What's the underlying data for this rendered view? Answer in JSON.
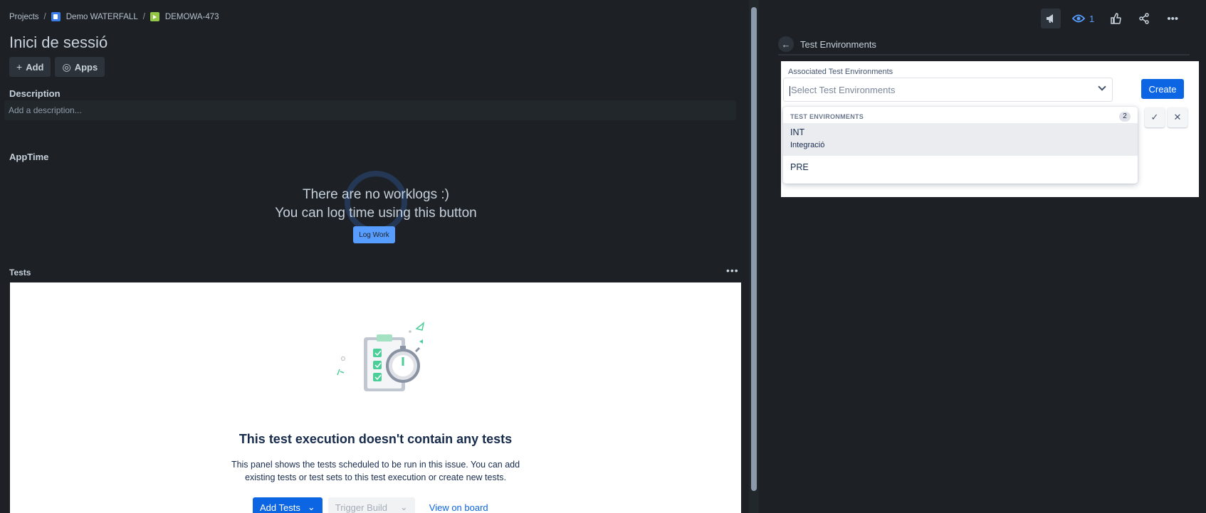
{
  "breadcrumb": {
    "projects": "Projects",
    "project": "Demo WATERFALL",
    "issue": "DEMOWA-473"
  },
  "issue": {
    "title": "Inici de sessió",
    "add_label": "Add",
    "apps_label": "Apps"
  },
  "description": {
    "label": "Description",
    "placeholder": "Add a description..."
  },
  "apptime": {
    "label": "AppTime",
    "line1": "There are no worklogs :)",
    "line2": "You can log time using this button",
    "button": "Log Work"
  },
  "tests": {
    "label": "Tests",
    "more": "•••",
    "empty_title": "This test execution doesn't contain any tests",
    "empty_body_1": "This panel shows the tests scheduled to be run in this issue. You can add",
    "empty_body_2": "existing tests or test sets to this test execution or create new tests.",
    "add_tests": "Add Tests",
    "trigger_build": "Trigger Build",
    "view_on_board": "View on board"
  },
  "header": {
    "watch_count": "1"
  },
  "panel": {
    "title": "Test Environments",
    "field_label": "Associated Test Environments",
    "select_placeholder": "Select Test Environments",
    "create": "Create",
    "dropdown": {
      "heading": "TEST ENVIRONMENTS",
      "count": "2",
      "items": [
        {
          "name": "INT",
          "description": "Integració"
        },
        {
          "name": "PRE",
          "description": ""
        }
      ]
    }
  },
  "colors": {
    "background": "#1d2125",
    "primary": "#0c66e4",
    "link_blue": "#579dff"
  }
}
